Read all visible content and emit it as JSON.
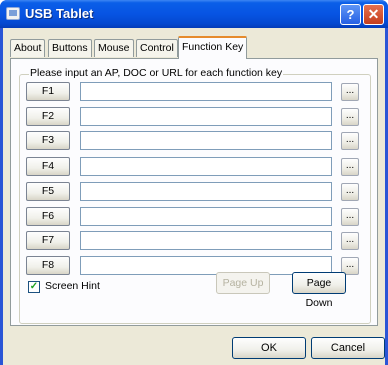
{
  "window": {
    "title": "USB Tablet",
    "help_glyph": "?",
    "close_glyph": "✕"
  },
  "tabs": [
    {
      "label": "About"
    },
    {
      "label": "Buttons"
    },
    {
      "label": "Mouse"
    },
    {
      "label": "Control"
    },
    {
      "label": "Function Key",
      "active": true
    }
  ],
  "function_keys": {
    "group_label": "Please input an AP, DOC or URL for each function key",
    "browse_label": "...",
    "rows": [
      {
        "key": "F1",
        "value": ""
      },
      {
        "key": "F2",
        "value": ""
      },
      {
        "key": "F3",
        "value": ""
      },
      {
        "key": "F4",
        "value": ""
      },
      {
        "key": "F5",
        "value": ""
      },
      {
        "key": "F6",
        "value": ""
      },
      {
        "key": "F7",
        "value": ""
      },
      {
        "key": "F8",
        "value": ""
      }
    ]
  },
  "screen_hint": {
    "label": "Screen Hint",
    "checked": true,
    "check_glyph": "✓"
  },
  "paging": {
    "page_up_label": "Page Up",
    "page_up_enabled": false,
    "page_down_label": "Page Down"
  },
  "dialog_buttons": {
    "ok_label": "OK",
    "cancel_label": "Cancel"
  },
  "colors": {
    "titlebar": "#0754e3",
    "active_tab_accent": "#e68b2c",
    "dialog_background": "#ece9d8"
  }
}
